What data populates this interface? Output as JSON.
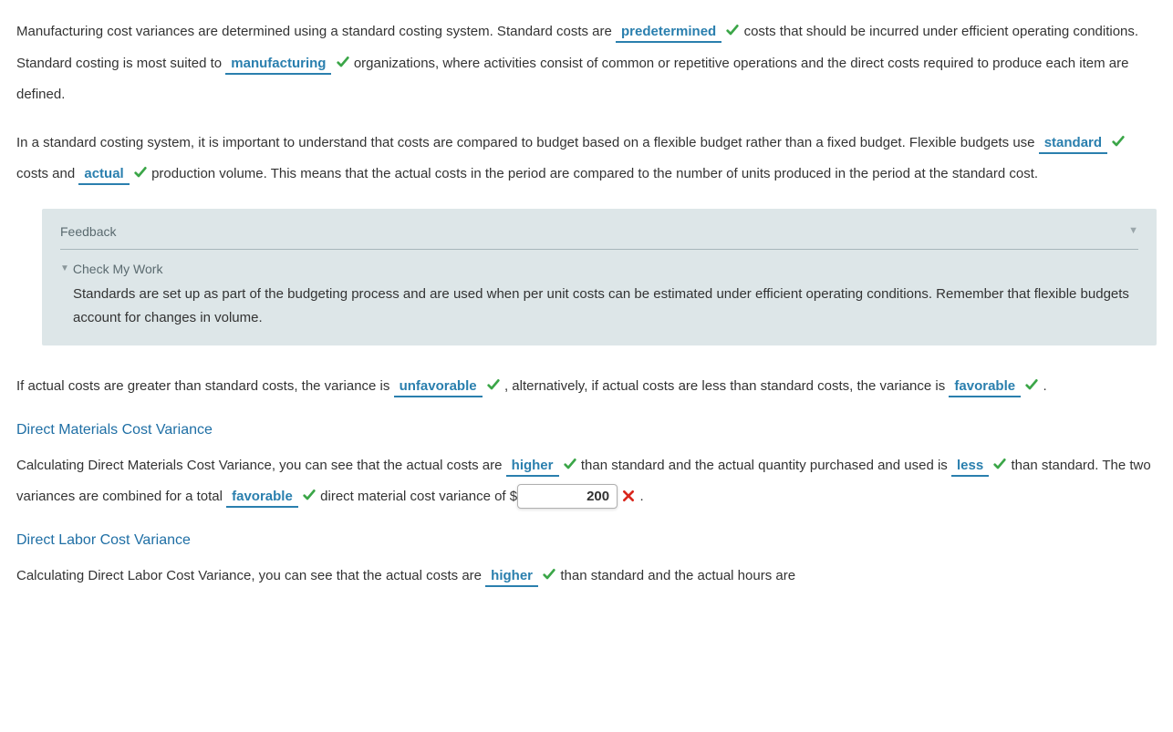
{
  "para1": {
    "t1": "Manufacturing cost variances are determined using a standard costing system. Standard costs are ",
    "a1": "predetermined",
    "t2": " costs that should be incurred under efficient operating conditions. Standard costing is most suited to ",
    "a2": "manufacturing",
    "t3": " organizations, where activities consist of common or repetitive operations and the direct costs required to produce each item are defined."
  },
  "para2": {
    "t1": "In a standard costing system, it is important to understand that costs are compared to budget based on a flexible budget rather than a fixed budget. Flexible budgets use ",
    "a1": "standard",
    "t2": " costs and ",
    "a2": "actual",
    "t3": " production volume. This means that the actual costs in the period are compared to the number of units produced in the period at the standard cost."
  },
  "feedback": {
    "title": "Feedback",
    "check_title": "Check My Work",
    "body": "Standards are set up as part of the budgeting process and are used when per unit costs can be estimated under efficient operating conditions. Remember that flexible budgets account for changes in volume."
  },
  "para3": {
    "t1": "If actual costs are greater than standard costs, the variance is ",
    "a1": "unfavorable",
    "t2": " , alternatively, if actual costs are less than standard costs, the variance is ",
    "a2": "favorable",
    "t3": " ."
  },
  "heading1": "Direct Materials Cost Variance",
  "para4": {
    "t1": "Calculating Direct Materials Cost Variance, you can see that the actual costs are ",
    "a1": "higher",
    "t2": " than standard and the actual quantity purchased and used is ",
    "a2": "less",
    "t3": " than standard. The two variances are combined for a total ",
    "a3": "favorable",
    "t4": " direct material cost variance of $",
    "input_val": "200",
    "t5": " ."
  },
  "heading2": "Direct Labor Cost Variance",
  "para5": {
    "t1": "Calculating Direct Labor Cost Variance, you can see that the actual costs are ",
    "a1": "higher",
    "t2": " than standard and the actual hours are"
  }
}
